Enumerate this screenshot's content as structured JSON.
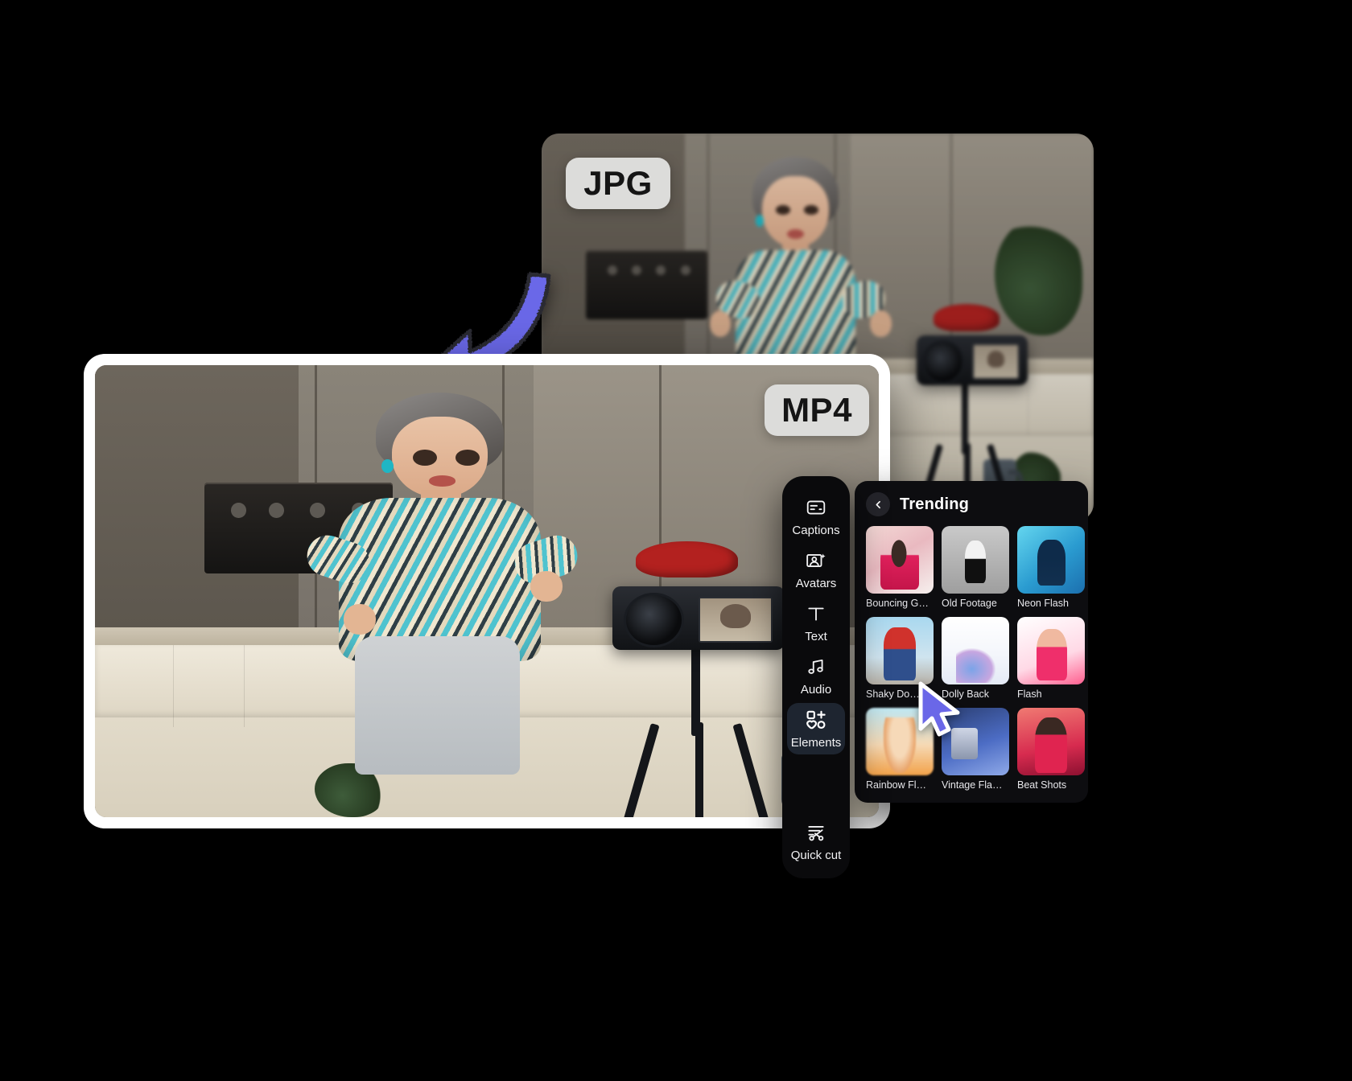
{
  "scene": {
    "background_color": "#000000",
    "accent_color": "#6a67e8"
  },
  "cards": {
    "back_card": {
      "format_badge": "JPG",
      "name": "jpg-preview-card"
    },
    "front_card": {
      "format_badge": "MP4",
      "name": "mp4-preview-card"
    }
  },
  "arrow": {
    "name": "curved-down-arrow",
    "color": "#6a67e8"
  },
  "toolbar": {
    "items": [
      {
        "label": "Captions",
        "icon": "captions-icon",
        "active": false
      },
      {
        "label": "Avatars",
        "icon": "avatars-icon",
        "active": false
      },
      {
        "label": "Text",
        "icon": "text-icon",
        "active": false
      },
      {
        "label": "Audio",
        "icon": "audio-icon",
        "active": false
      },
      {
        "label": "Elements",
        "icon": "elements-icon",
        "active": true
      },
      {
        "label": "Quick cut",
        "icon": "quick-cut-icon",
        "active": false
      }
    ]
  },
  "panel": {
    "title": "Trending",
    "back_icon": "chevron-left-icon",
    "tiles": [
      {
        "label": "Bouncing G…"
      },
      {
        "label": "Old Footage"
      },
      {
        "label": "Neon Flash"
      },
      {
        "label": "Shaky Do…"
      },
      {
        "label": "Dolly Back"
      },
      {
        "label": "Flash"
      },
      {
        "label": "Rainbow Fl…"
      },
      {
        "label": "Vintage Fla…"
      },
      {
        "label": "Beat Shots"
      }
    ]
  },
  "cursor": {
    "name": "mouse-pointer",
    "color": "#6a67e8"
  }
}
